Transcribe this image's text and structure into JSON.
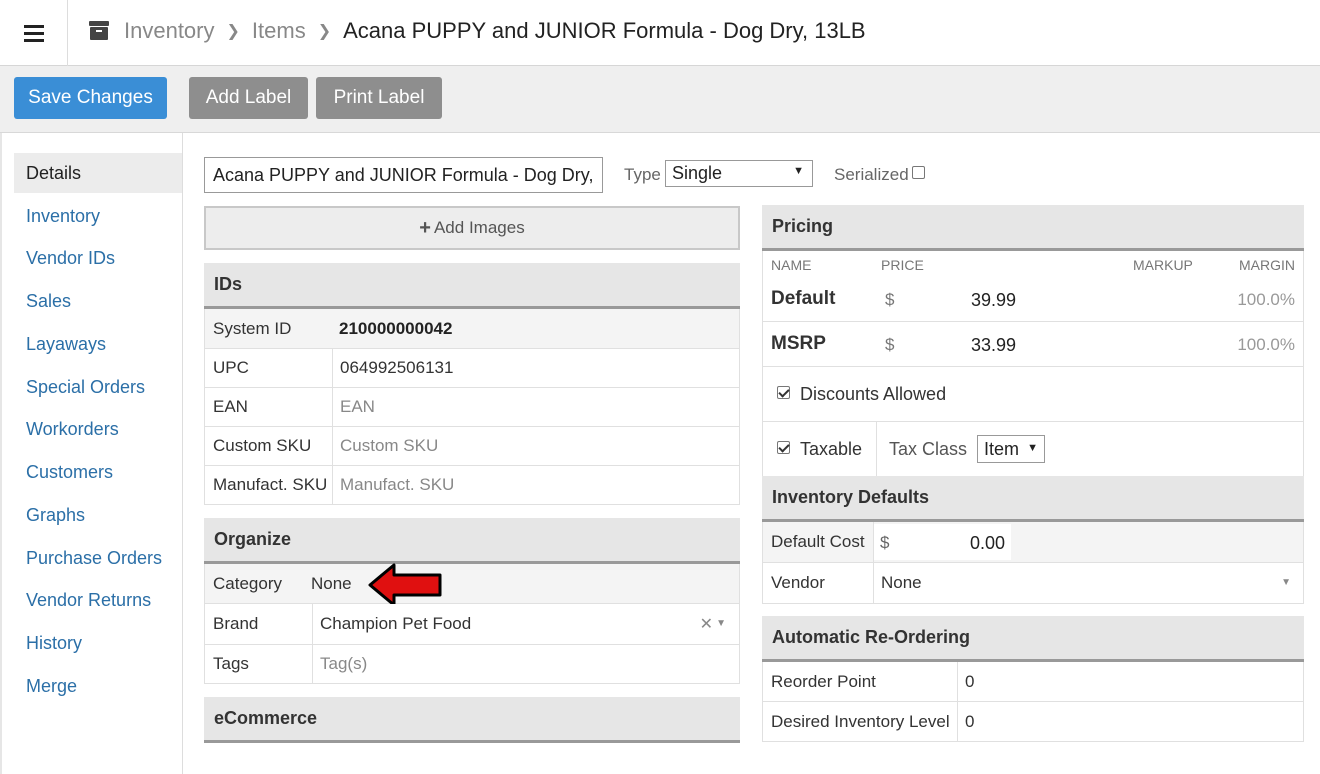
{
  "breadcrumb": {
    "root": "Inventory",
    "section": "Items",
    "current": "Acana PUPPY and JUNIOR Formula - Dog Dry, 13LB"
  },
  "toolbar": {
    "save_label": "Save Changes",
    "add_label": "Add Label",
    "print_label": "Print Label"
  },
  "sidebar": {
    "items": [
      {
        "label": "Details",
        "active": true
      },
      {
        "label": "Inventory"
      },
      {
        "label": "Vendor IDs"
      },
      {
        "label": "Sales"
      },
      {
        "label": "Layaways"
      },
      {
        "label": "Special Orders"
      },
      {
        "label": "Workorders"
      },
      {
        "label": "Customers"
      },
      {
        "label": "Graphs"
      },
      {
        "label": "Purchase Orders"
      },
      {
        "label": "Vendor Returns"
      },
      {
        "label": "History"
      },
      {
        "label": "Merge"
      }
    ]
  },
  "item": {
    "name_value": "Acana PUPPY and JUNIOR Formula - Dog Dry, 1",
    "type_label": "Type",
    "type_value": "Single",
    "serialized_label": "Serialized",
    "serialized": false,
    "add_images_label": "Add Images"
  },
  "ids": {
    "title": "IDs",
    "system_id_label": "System ID",
    "system_id": "210000000042",
    "upc_label": "UPC",
    "upc": "064992506131",
    "ean_label": "EAN",
    "ean_placeholder": "EAN",
    "custom_sku_label": "Custom SKU",
    "custom_sku_placeholder": "Custom SKU",
    "manufact_sku_label": "Manufact. SKU",
    "manufact_sku_placeholder": "Manufact. SKU"
  },
  "organize": {
    "title": "Organize",
    "category_label": "Category",
    "category_value": "None",
    "brand_label": "Brand",
    "brand_value": "Champion Pet Food",
    "tags_label": "Tags",
    "tags_placeholder": "Tag(s)"
  },
  "ecommerce": {
    "title": "eCommerce"
  },
  "pricing": {
    "title": "Pricing",
    "columns": {
      "name": "NAME",
      "price": "PRICE",
      "markup": "MARKUP",
      "margin": "MARGIN"
    },
    "rows": [
      {
        "name": "Default",
        "currency": "$",
        "price": "39.99",
        "margin": "100.0%"
      },
      {
        "name": "MSRP",
        "currency": "$",
        "price": "33.99",
        "margin": "100.0%"
      }
    ],
    "discounts_label": "Discounts Allowed",
    "discounts_allowed": true,
    "taxable_label": "Taxable",
    "taxable": true,
    "tax_class_label": "Tax Class",
    "tax_class_value": "Item"
  },
  "inventory_defaults": {
    "title": "Inventory Defaults",
    "default_cost_label": "Default Cost",
    "currency": "$",
    "default_cost": "0.00",
    "vendor_label": "Vendor",
    "vendor_value": "None"
  },
  "reordering": {
    "title": "Automatic Re-Ordering",
    "reorder_point_label": "Reorder Point",
    "reorder_point": "0",
    "desired_level_label": "Desired Inventory Level",
    "desired_level": "0"
  },
  "colors": {
    "primary": "#3a8ed6",
    "secondary_button": "#8e8e8e",
    "link": "#2b6fa7",
    "annotation_arrow": "#e01010"
  }
}
